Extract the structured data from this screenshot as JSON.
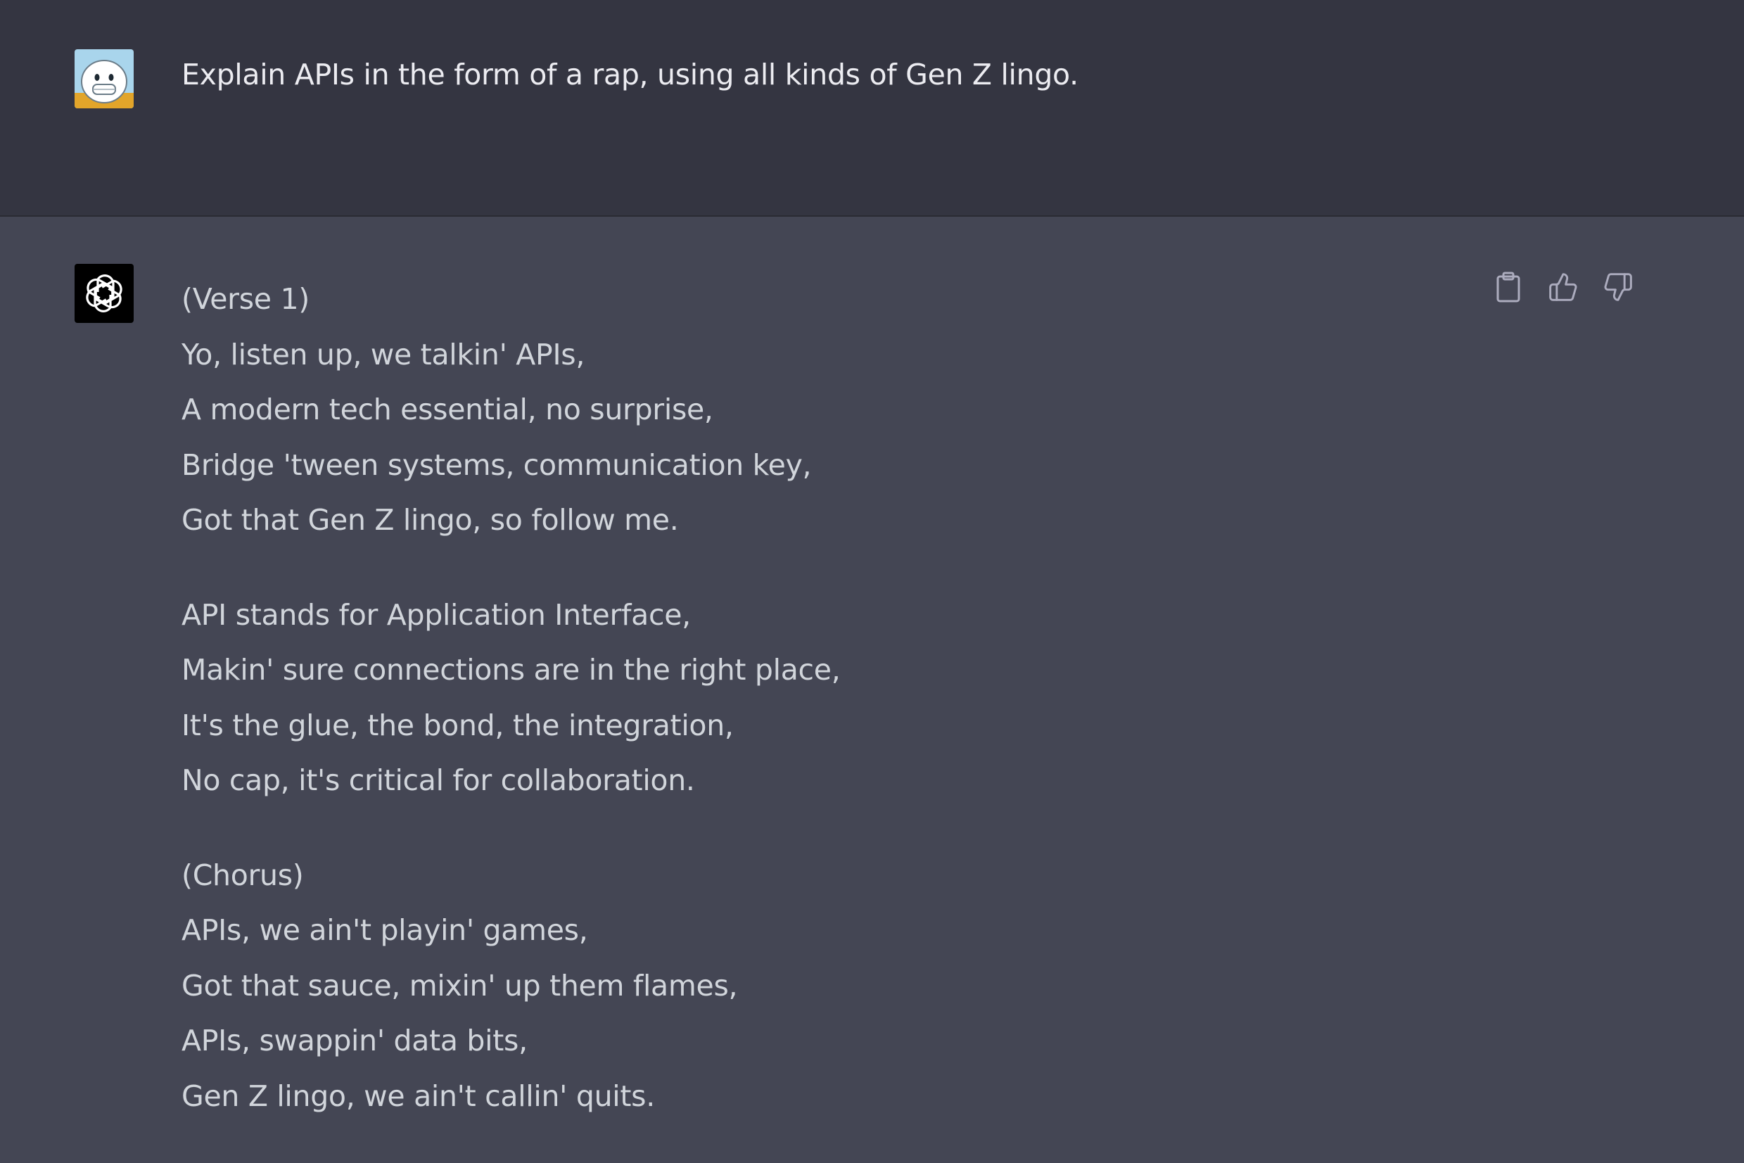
{
  "user_message": {
    "avatar": "user-avatar",
    "text": "Explain APIs in the form of a rap, using all kinds of Gen Z lingo."
  },
  "assistant_message": {
    "avatar": "openai-logo-icon",
    "stanzas": [
      [
        "(Verse 1)",
        "Yo, listen up, we talkin' APIs,",
        "A modern tech essential, no surprise,",
        "Bridge 'tween systems, communication key,",
        "Got that Gen Z lingo, so follow me."
      ],
      [
        "API stands for Application Interface,",
        "Makin' sure connections are in the right place,",
        "It's the glue, the bond, the integration,",
        "No cap, it's critical for collaboration."
      ],
      [
        "(Chorus)",
        "APIs, we ain't playin' games,",
        "Got that sauce, mixin' up them flames,",
        "APIs, swappin' data bits,",
        "Gen Z lingo, we ain't callin' quits."
      ]
    ],
    "actions": [
      "copy-icon",
      "thumbs-up-icon",
      "thumbs-down-icon"
    ]
  },
  "colors": {
    "user_bg": "#343541",
    "assistant_bg": "#444654",
    "text": "#ececf1"
  }
}
